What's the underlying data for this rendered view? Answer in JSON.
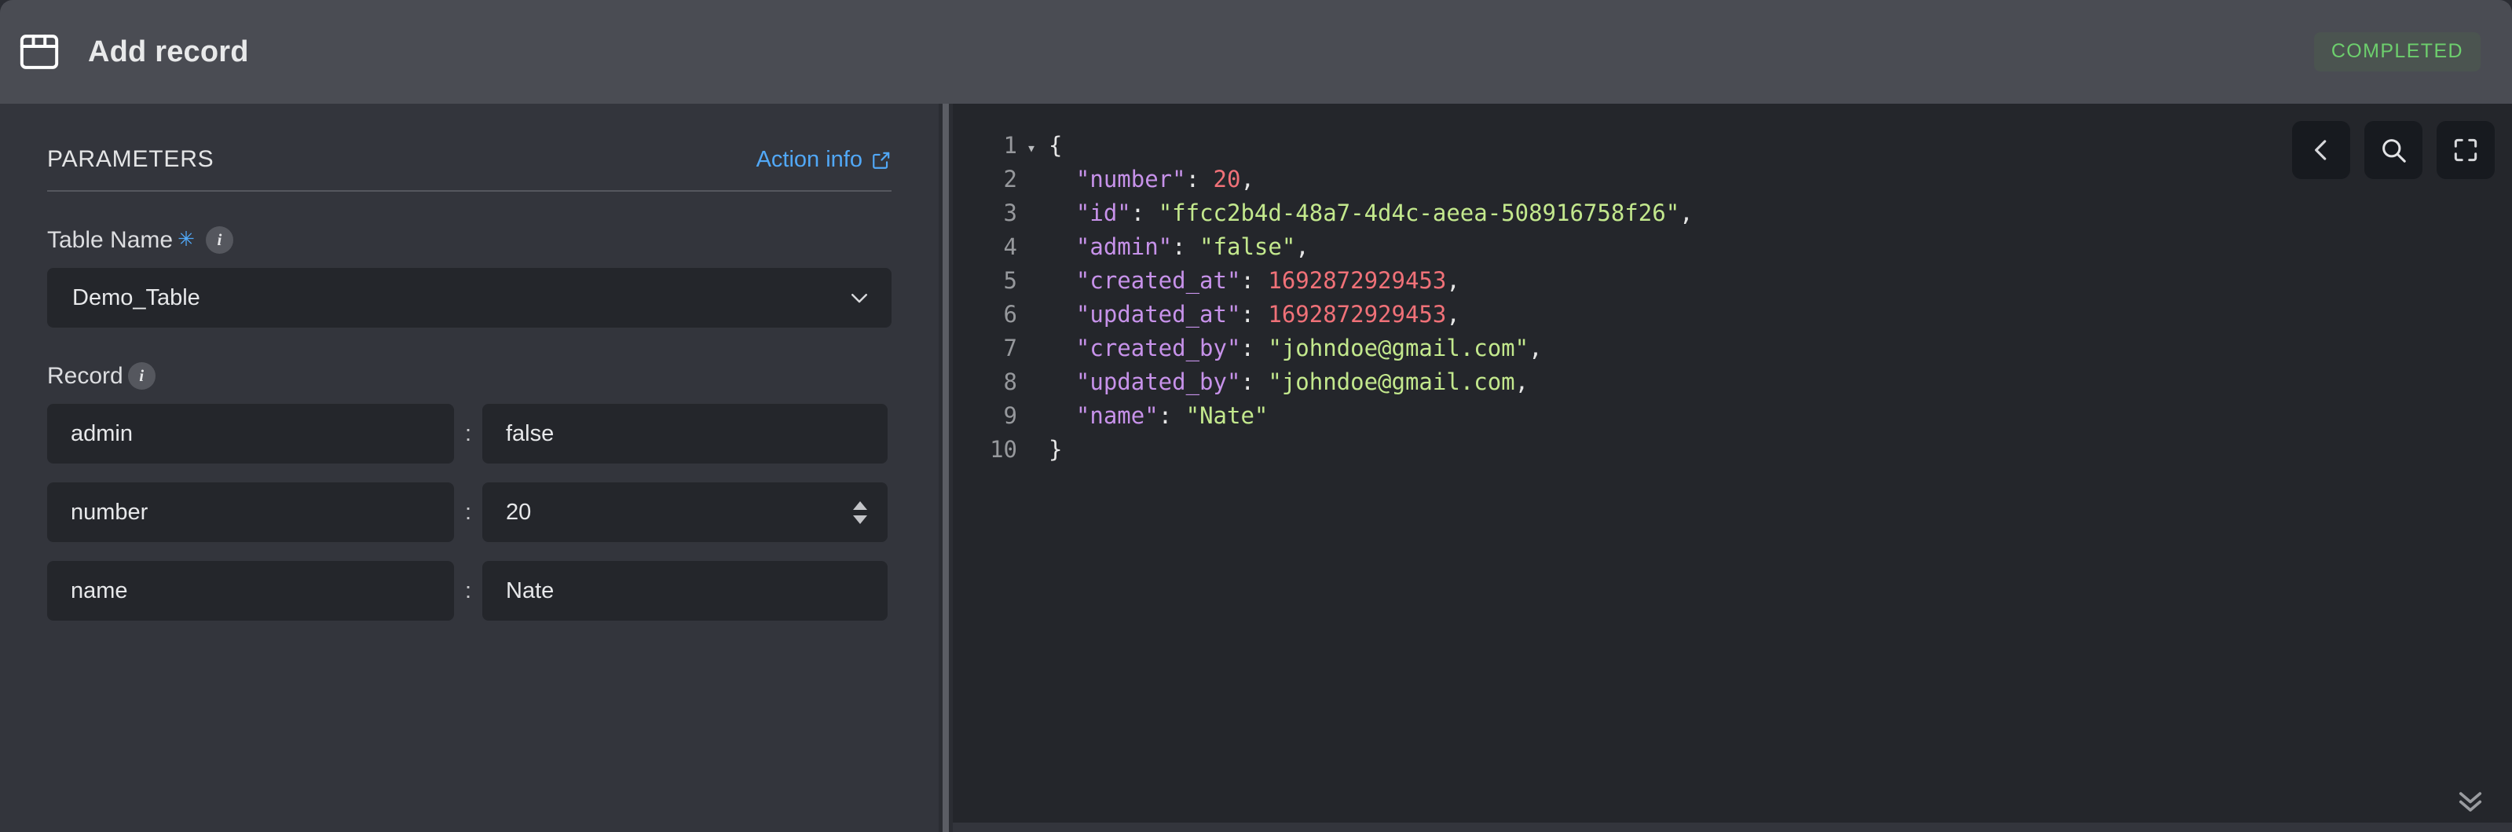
{
  "titlebar": {
    "icon": "window-table-icon",
    "title": "Add record",
    "status": "COMPLETED",
    "status_color": "#6dcf6d",
    "status_bg": "#4b5450"
  },
  "left_panel": {
    "section_title": "PARAMETERS",
    "action_info_label": "Action info",
    "action_info_icon": "external-link-icon",
    "accent_color": "#51a8f7",
    "fields": {
      "table_name": {
        "label": "Table Name",
        "required_marker": "✳",
        "info_icon": "info-circle-icon",
        "info_glyph": "i",
        "selected_value": "Demo_Table",
        "dropdown_icon": "chevron-down-icon"
      },
      "record": {
        "label": "Record",
        "info_icon": "info-circle-icon",
        "info_glyph": "i",
        "separator": ":",
        "rows": [
          {
            "key": "admin",
            "value": "false",
            "control": "text"
          },
          {
            "key": "number",
            "value": "20",
            "control": "number-stepper"
          },
          {
            "key": "name",
            "value": "Nate",
            "control": "text"
          }
        ]
      }
    }
  },
  "right_panel": {
    "toolbar": [
      {
        "name": "collapse-button",
        "icon": "chevron-left-icon"
      },
      {
        "name": "search-button",
        "icon": "search-icon"
      },
      {
        "name": "fullscreen-button",
        "icon": "fullscreen-icon"
      }
    ],
    "scroll_bottom_icon": "chevron-double-down-icon",
    "syntax_colors": {
      "key": "#c792ea",
      "string": "#c3e88d",
      "number": "#f07178",
      "punctuation": "#e6e6e6",
      "line_number": "#96989c",
      "background": "#24262b"
    },
    "code": {
      "language": "json",
      "lines": [
        {
          "n": "1",
          "fold": "▾",
          "tokens": [
            {
              "t": "{",
              "c": "punct"
            }
          ]
        },
        {
          "n": "2",
          "fold": "",
          "tokens": [
            {
              "t": "  \"number\"",
              "c": "key"
            },
            {
              "t": ": ",
              "c": "punct"
            },
            {
              "t": "20",
              "c": "num"
            },
            {
              "t": ",",
              "c": "punct"
            }
          ]
        },
        {
          "n": "3",
          "fold": "",
          "tokens": [
            {
              "t": "  \"id\"",
              "c": "key"
            },
            {
              "t": ": ",
              "c": "punct"
            },
            {
              "t": "\"ffcc2b4d-48a7-4d4c-aeea-508916758f26\"",
              "c": "str"
            },
            {
              "t": ",",
              "c": "punct"
            }
          ]
        },
        {
          "n": "4",
          "fold": "",
          "tokens": [
            {
              "t": "  \"admin\"",
              "c": "key"
            },
            {
              "t": ": ",
              "c": "punct"
            },
            {
              "t": "\"false\"",
              "c": "str"
            },
            {
              "t": ",",
              "c": "punct"
            }
          ]
        },
        {
          "n": "5",
          "fold": "",
          "tokens": [
            {
              "t": "  \"created_at\"",
              "c": "key"
            },
            {
              "t": ": ",
              "c": "punct"
            },
            {
              "t": "1692872929453",
              "c": "num"
            },
            {
              "t": ",",
              "c": "punct"
            }
          ]
        },
        {
          "n": "6",
          "fold": "",
          "tokens": [
            {
              "t": "  \"updated_at\"",
              "c": "key"
            },
            {
              "t": ": ",
              "c": "punct"
            },
            {
              "t": "1692872929453",
              "c": "num"
            },
            {
              "t": ",",
              "c": "punct"
            }
          ]
        },
        {
          "n": "7",
          "fold": "",
          "tokens": [
            {
              "t": "  \"created_by\"",
              "c": "key"
            },
            {
              "t": ": ",
              "c": "punct"
            },
            {
              "t": "\"johndoe@gmail.com\"",
              "c": "str"
            },
            {
              "t": ",",
              "c": "punct"
            }
          ]
        },
        {
          "n": "8",
          "fold": "",
          "tokens": [
            {
              "t": "  \"updated_by\"",
              "c": "key"
            },
            {
              "t": ": ",
              "c": "punct"
            },
            {
              "t": "\"johndoe@gmail.com",
              "c": "str"
            },
            {
              "t": ",",
              "c": "punct"
            }
          ]
        },
        {
          "n": "9",
          "fold": "",
          "tokens": [
            {
              "t": "  \"name\"",
              "c": "key"
            },
            {
              "t": ": ",
              "c": "punct"
            },
            {
              "t": "\"Nate\"",
              "c": "str"
            }
          ]
        },
        {
          "n": "10",
          "fold": "",
          "tokens": [
            {
              "t": "}",
              "c": "punct"
            }
          ]
        }
      ]
    }
  }
}
